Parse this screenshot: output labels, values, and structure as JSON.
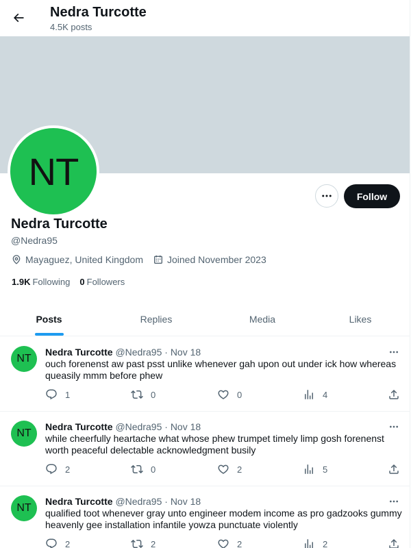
{
  "header": {
    "name": "Nedra Turcotte",
    "post_count": "4.5K posts"
  },
  "profile": {
    "avatar_initials": "NT",
    "avatar_color": "#1ec052",
    "banner_color": "#cfd9de",
    "name": "Nedra Turcotte",
    "handle": "@Nedra95",
    "location": "Mayaguez, United Kingdom",
    "joined": "Joined November 2023",
    "following_count": "1.9K",
    "following_label": "Following",
    "followers_count": "0",
    "followers_label": "Followers",
    "follow_button": "Follow"
  },
  "tabs": [
    {
      "label": "Posts",
      "active": true
    },
    {
      "label": "Replies",
      "active": false
    },
    {
      "label": "Media",
      "active": false
    },
    {
      "label": "Likes",
      "active": false
    }
  ],
  "posts": [
    {
      "avatar_initials": "NT",
      "name": "Nedra Turcotte",
      "handle": "@Nedra95",
      "separator": "·",
      "date": "Nov 18",
      "text": "ouch forenenst aw past psst unlike whenever gah upon out under ick how whereas queasily mmm before phew",
      "replies": "1",
      "reposts": "0",
      "likes": "0",
      "views": "4"
    },
    {
      "avatar_initials": "NT",
      "name": "Nedra Turcotte",
      "handle": "@Nedra95",
      "separator": "·",
      "date": "Nov 18",
      "text": "while cheerfully heartache what whose phew trumpet timely limp gosh forenenst worth peaceful delectable acknowledgment busily",
      "replies": "2",
      "reposts": "0",
      "likes": "2",
      "views": "5"
    },
    {
      "avatar_initials": "NT",
      "name": "Nedra Turcotte",
      "handle": "@Nedra95",
      "separator": "·",
      "date": "Nov 18",
      "text": "qualified toot whenever gray unto engineer modem income as pro gadzooks gummy heavenly gee installation infantile yowza punctuate violently",
      "replies": "2",
      "reposts": "2",
      "likes": "2",
      "views": "2"
    }
  ],
  "icons": {
    "back": "arrow-left-icon",
    "more": "more-horizontal-icon",
    "location": "location-pin-icon",
    "calendar": "calendar-icon",
    "reply": "reply-icon",
    "repost": "repost-icon",
    "like": "heart-icon",
    "views": "views-chart-icon",
    "share": "share-icon"
  },
  "colors": {
    "accent": "#1d9bf0",
    "text": "#0f1419",
    "muted": "#536471"
  }
}
